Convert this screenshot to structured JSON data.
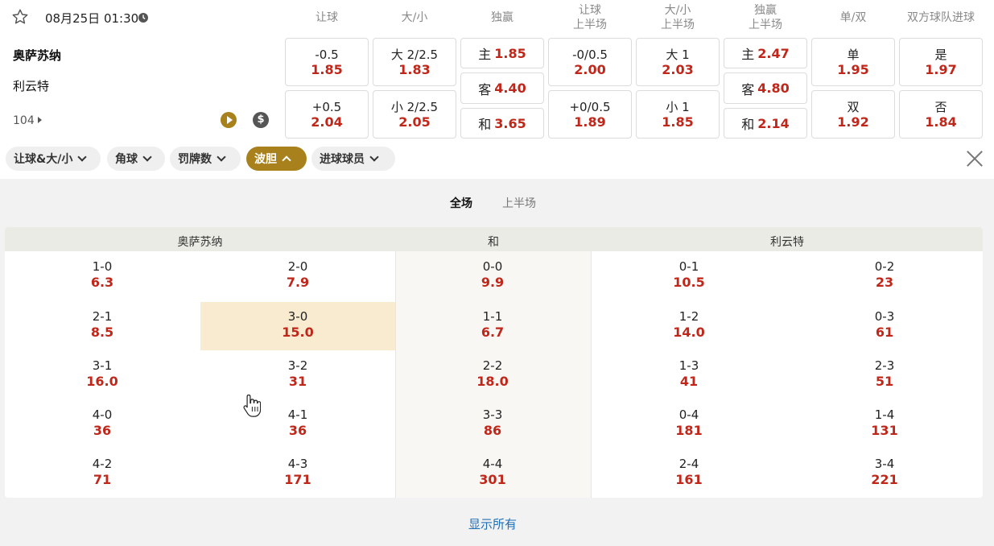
{
  "header": {
    "datetime": "08月25日 01:30"
  },
  "columns": [
    {
      "l1": "让球",
      "l2": ""
    },
    {
      "l1": "大/小",
      "l2": ""
    },
    {
      "l1": "独赢",
      "l2": ""
    },
    {
      "l1": "让球",
      "l2": "上半场"
    },
    {
      "l1": "大/小",
      "l2": "上半场"
    },
    {
      "l1": "独赢",
      "l2": "上半场"
    },
    {
      "l1": "单/双",
      "l2": ""
    },
    {
      "l1": "双方球队进球",
      "l2": ""
    }
  ],
  "match": {
    "home": "奥萨苏纳",
    "away": "利云特",
    "more_count": "104"
  },
  "odds": {
    "handicap": [
      {
        "line": "-0.5",
        "odd": "1.85"
      },
      {
        "line": "+0.5",
        "odd": "2.04"
      }
    ],
    "total": [
      {
        "line": "大 2/2.5",
        "odd": "1.83"
      },
      {
        "line": "小 2/2.5",
        "odd": "2.05"
      }
    ],
    "moneyline": [
      {
        "label": "主",
        "odd": "1.85"
      },
      {
        "label": "客",
        "odd": "4.40"
      },
      {
        "label": "和",
        "odd": "3.65"
      }
    ],
    "handicap_1h": [
      {
        "line": "-0/0.5",
        "odd": "2.00"
      },
      {
        "line": "+0/0.5",
        "odd": "1.89"
      }
    ],
    "total_1h": [
      {
        "line": "大 1",
        "odd": "2.03"
      },
      {
        "line": "小 1",
        "odd": "1.85"
      }
    ],
    "moneyline_1h": [
      {
        "label": "主",
        "odd": "2.47"
      },
      {
        "label": "客",
        "odd": "4.80"
      },
      {
        "label": "和",
        "odd": "2.14"
      }
    ],
    "odd_even": [
      {
        "line": "单",
        "odd": "1.95"
      },
      {
        "line": "双",
        "odd": "1.92"
      }
    ],
    "btts": [
      {
        "line": "是",
        "odd": "1.97"
      },
      {
        "line": "否",
        "odd": "1.84"
      }
    ]
  },
  "tabs": [
    {
      "label": "让球&大/小",
      "active": false
    },
    {
      "label": "角球",
      "active": false
    },
    {
      "label": "罚牌数",
      "active": false
    },
    {
      "label": "波胆",
      "active": true
    },
    {
      "label": "进球球员",
      "active": false
    }
  ],
  "period_tabs": {
    "full": "全场",
    "first_half": "上半场"
  },
  "correct_score": {
    "group_headers": {
      "home": "奥萨苏纳",
      "draw": "和",
      "away": "利云特"
    },
    "home_a": [
      {
        "s": "1-0",
        "o": "6.3"
      },
      {
        "s": "2-1",
        "o": "8.5"
      },
      {
        "s": "3-1",
        "o": "16.0"
      },
      {
        "s": "4-0",
        "o": "36"
      },
      {
        "s": "4-2",
        "o": "71"
      }
    ],
    "home_b": [
      {
        "s": "2-0",
        "o": "7.9"
      },
      {
        "s": "3-0",
        "o": "15.0"
      },
      {
        "s": "3-2",
        "o": "31"
      },
      {
        "s": "4-1",
        "o": "36"
      },
      {
        "s": "4-3",
        "o": "171"
      }
    ],
    "draw": [
      {
        "s": "0-0",
        "o": "9.9"
      },
      {
        "s": "1-1",
        "o": "6.7"
      },
      {
        "s": "2-2",
        "o": "18.0"
      },
      {
        "s": "3-3",
        "o": "86"
      },
      {
        "s": "4-4",
        "o": "301"
      }
    ],
    "away_a": [
      {
        "s": "0-1",
        "o": "10.5"
      },
      {
        "s": "1-2",
        "o": "14.0"
      },
      {
        "s": "1-3",
        "o": "41"
      },
      {
        "s": "0-4",
        "o": "181"
      },
      {
        "s": "2-4",
        "o": "161"
      }
    ],
    "away_b": [
      {
        "s": "0-2",
        "o": "23"
      },
      {
        "s": "0-3",
        "o": "61"
      },
      {
        "s": "2-3",
        "o": "51"
      },
      {
        "s": "1-4",
        "o": "131"
      },
      {
        "s": "3-4",
        "o": "221"
      }
    ]
  },
  "show_all": "显示所有",
  "colors": {
    "accent": "#a8811d",
    "odds_red": "#c0271b",
    "highlight": "#f8ebcf",
    "link": "#1f6fb7"
  }
}
